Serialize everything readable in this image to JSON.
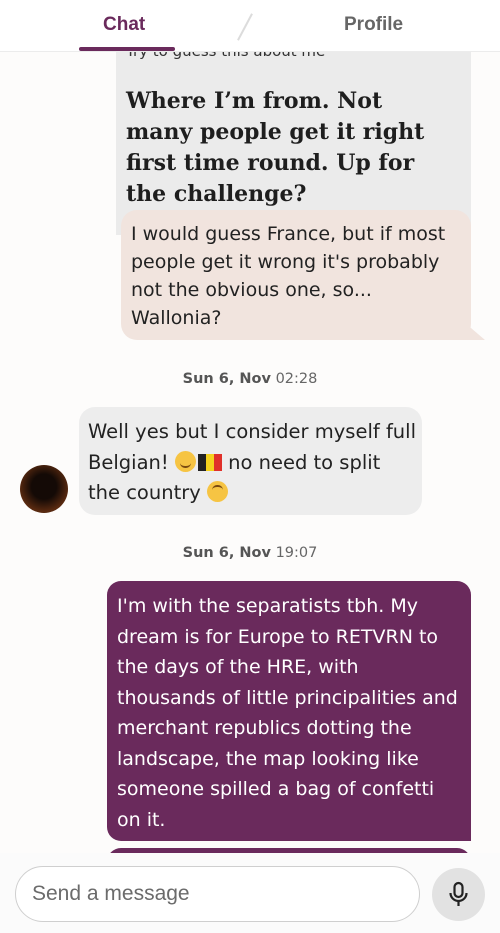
{
  "tabs": {
    "chat_label": "Chat",
    "profile_label": "Profile"
  },
  "prompt": {
    "subtitle": "Try to guess this about me",
    "answer": "Where I’m from. Not many people get it right first time round. Up for the challenge?"
  },
  "messages": {
    "reply": "I would guess France, but if most people get it wrong it's probably not the obvious one, so... Wallonia?",
    "ts1_date": "Sun 6, Nov",
    "ts1_time": "02:28",
    "incoming_part1": "Well yes but I consider myself full Belgian! ",
    "incoming_part2": " no need to split the country ",
    "ts2_date": "Sun 6, Nov",
    "ts2_time": "19:07",
    "outgoing": "I'm with the separatists tbh. My dream is for Europe to RETVRN to the days of the HRE, with thousands of little principalities and merchant republics dotting the landscape, the map looking like someone spilled a bag of confetti on it."
  },
  "composer": {
    "placeholder": "Send a message"
  },
  "icons": {
    "emoji_wink": "winking-face",
    "flag": "belgium-flag",
    "emoji_upside_down": "upside-down-face",
    "mic": "microphone"
  },
  "colors": {
    "accent": "#6a2a5c",
    "reply_bubble": "#f1e4de",
    "incoming_bubble": "#ededed",
    "prompt_card": "#ebebeb"
  }
}
